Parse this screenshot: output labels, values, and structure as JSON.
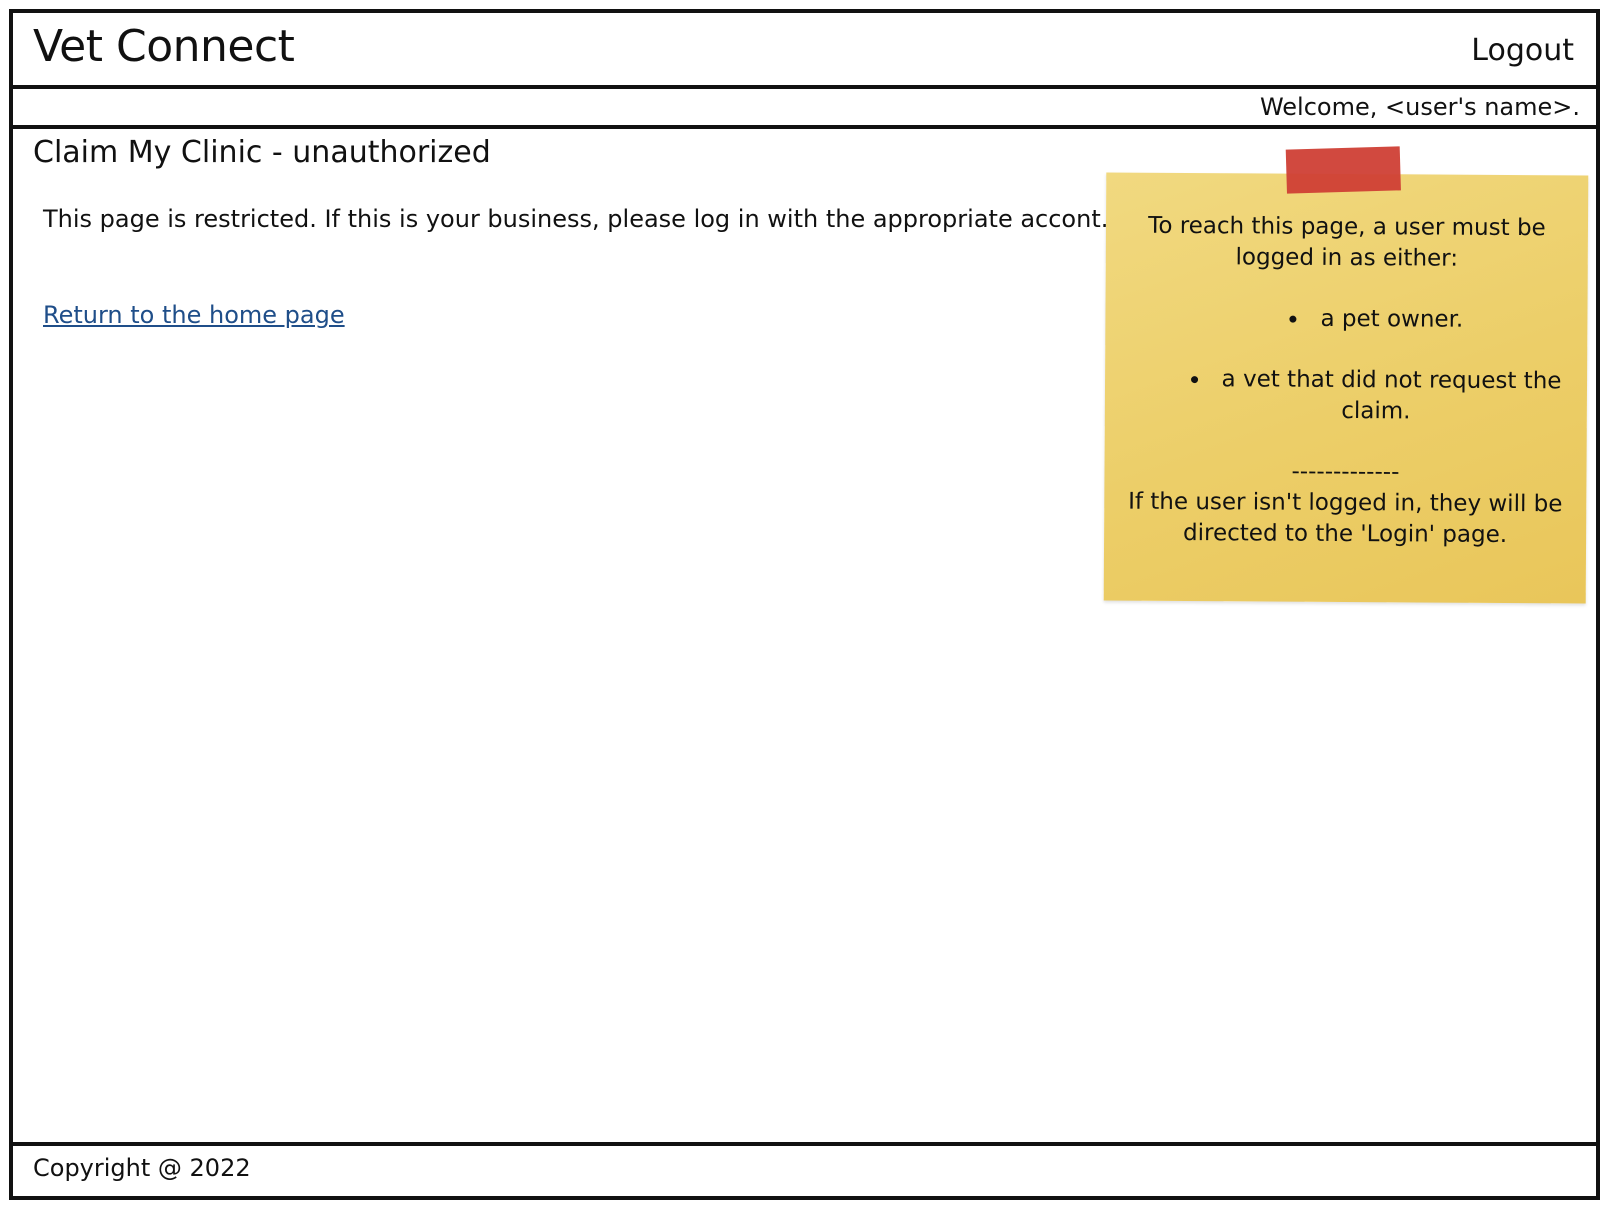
{
  "header": {
    "app_title": "Vet Connect",
    "logout_label": "Logout"
  },
  "welcome": {
    "text": "Welcome, <user's name>."
  },
  "main": {
    "heading": "Claim My Clinic - unauthorized",
    "restricted_message": "This page is restricted.  If this is your business, please log in with the appropriate accont.",
    "home_link_label": "Return to the home page"
  },
  "sticky_note": {
    "intro": "To reach this page, a user must be logged in as either:",
    "bullets": [
      "a pet owner.",
      "a vet that did not request the claim."
    ],
    "divider": "-------------",
    "redirect_note": "If the user isn't logged in, they will be directed to the 'Login' page.",
    "colors": {
      "note": "#ecce68",
      "tape": "#cf3f35"
    }
  },
  "footer": {
    "copyright": "Copyright @ 2022"
  },
  "colors": {
    "link": "#1f4e89",
    "border": "#111111"
  }
}
